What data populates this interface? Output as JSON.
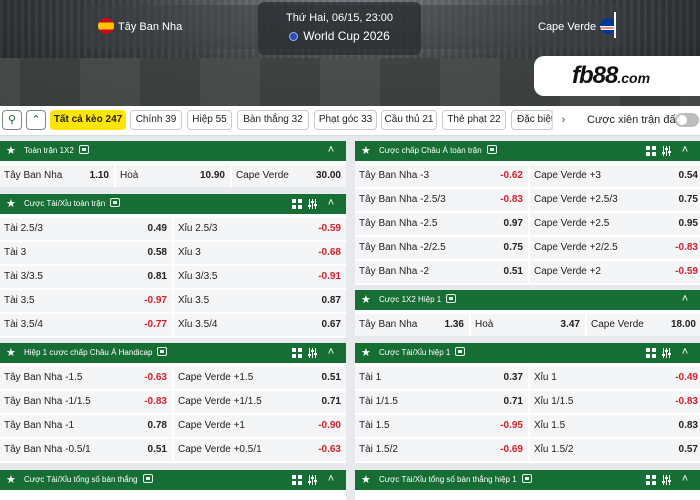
{
  "match": {
    "home_team": "Tây Ban Nha",
    "away_team": "Cape Verde",
    "datetime": "Thứ Hai, 06/15, 23:00",
    "league": "World Cup 2026"
  },
  "brand": {
    "logo": "fb88",
    "logo_suffix": ".com"
  },
  "tabs": [
    {
      "label": "Tất cả kèo 247",
      "active": true
    },
    {
      "label": "Chính 39"
    },
    {
      "label": "Hiệp 55"
    },
    {
      "label": "Bàn thắng 32"
    },
    {
      "label": "Phạt góc 33"
    },
    {
      "label": "Cầu thủ 21"
    },
    {
      "label": "Thẻ phạt 22"
    },
    {
      "label": "Đặc biệt"
    }
  ],
  "parlay_label": "Cược xiên trận đấu",
  "icons": {
    "search": "search-icon",
    "collapse": "double-chevron-up-icon",
    "next": "chevron-right-icon",
    "star": "star-icon",
    "grid": "grid-icon",
    "sliders": "sliders-icon",
    "chevron_up": "chevron-up-icon",
    "live_tv": "tv-icon"
  },
  "colors": {
    "header_green": "#176e34",
    "tab_active": "#ffe600",
    "negative_odd": "#d4202a"
  },
  "panels": {
    "p1": {
      "title": "Toàn trận 1X2",
      "rows": [
        [
          [
            "Tây Ban Nha",
            "1.10"
          ],
          [
            "Hoà",
            "10.90"
          ],
          [
            "Cape Verde",
            "30.00"
          ]
        ]
      ]
    },
    "p2": {
      "title": "Cược Tài/Xỉu toàn trận",
      "rows": [
        [
          [
            "Tài 2.5/3",
            "0.49"
          ],
          [
            "Xỉu 2.5/3",
            "-0.59"
          ]
        ],
        [
          [
            "Tài 3",
            "0.58"
          ],
          [
            "Xỉu 3",
            "-0.68"
          ]
        ],
        [
          [
            "Tài 3/3.5",
            "0.81"
          ],
          [
            "Xỉu 3/3.5",
            "-0.91"
          ]
        ],
        [
          [
            "Tài 3.5",
            "-0.97"
          ],
          [
            "Xỉu 3.5",
            "0.87"
          ]
        ],
        [
          [
            "Tài 3.5/4",
            "-0.77"
          ],
          [
            "Xỉu 3.5/4",
            "0.67"
          ]
        ]
      ]
    },
    "p3": {
      "title": "Hiệp 1 cược chấp Châu Á Handicap",
      "rows": [
        [
          [
            "Tây Ban Nha -1.5",
            "-0.63"
          ],
          [
            "Cape Verde +1.5",
            "0.51"
          ]
        ],
        [
          [
            "Tây Ban Nha -1/1.5",
            "-0.83"
          ],
          [
            "Cape Verde +1/1.5",
            "0.71"
          ]
        ],
        [
          [
            "Tây Ban Nha -1",
            "0.78"
          ],
          [
            "Cape Verde +1",
            "-0.90"
          ]
        ],
        [
          [
            "Tây Ban Nha -0.5/1",
            "0.51"
          ],
          [
            "Cape Verde +0.5/1",
            "-0.63"
          ]
        ]
      ]
    },
    "p4": {
      "title": "Cược Tài/Xỉu tổng số bàn thắng"
    },
    "p5": {
      "title": "Cược chấp Châu Á toàn trận",
      "rows": [
        [
          [
            "Tây Ban Nha -3",
            "-0.62"
          ],
          [
            "Cape Verde +3",
            "0.54"
          ]
        ],
        [
          [
            "Tây Ban Nha -2.5/3",
            "-0.83"
          ],
          [
            "Cape Verde +2.5/3",
            "0.75"
          ]
        ],
        [
          [
            "Tây Ban Nha -2.5",
            "0.97"
          ],
          [
            "Cape Verde +2.5",
            "0.95"
          ]
        ],
        [
          [
            "Tây Ban Nha -2/2.5",
            "0.75"
          ],
          [
            "Cape Verde +2/2.5",
            "-0.83"
          ]
        ],
        [
          [
            "Tây Ban Nha -2",
            "0.51"
          ],
          [
            "Cape Verde +2",
            "-0.59"
          ]
        ]
      ]
    },
    "p6": {
      "title": "Cược 1X2 Hiệp 1",
      "rows": [
        [
          [
            "Tây Ban Nha",
            "1.36"
          ],
          [
            "Hoà",
            "3.47"
          ],
          [
            "Cape Verde",
            "18.00"
          ]
        ]
      ]
    },
    "p7": {
      "title": "Cược Tài/Xỉu hiệp 1",
      "rows": [
        [
          [
            "Tài 1",
            "0.37"
          ],
          [
            "Xỉu 1",
            "-0.49"
          ]
        ],
        [
          [
            "Tài 1/1.5",
            "0.71"
          ],
          [
            "Xỉu 1/1.5",
            "-0.83"
          ]
        ],
        [
          [
            "Tài 1.5",
            "-0.95"
          ],
          [
            "Xỉu 1.5",
            "0.83"
          ]
        ],
        [
          [
            "Tài 1.5/2",
            "-0.69"
          ],
          [
            "Xỉu 1.5/2",
            "0.57"
          ]
        ]
      ]
    },
    "p8": {
      "title": "Cược Tài/Xỉu tổng số bàn thắng hiệp 1"
    }
  }
}
